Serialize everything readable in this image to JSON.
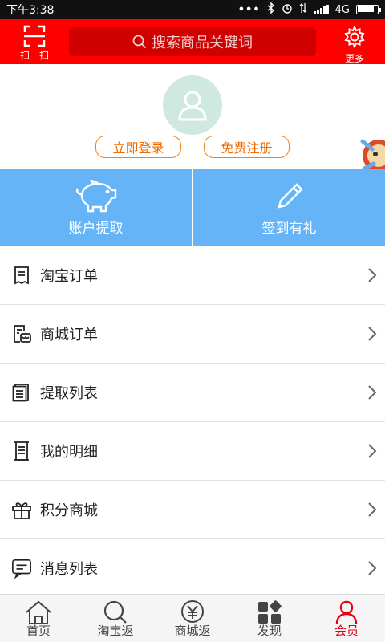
{
  "status": {
    "time": "下午3:38",
    "dots": "•••",
    "network": "4G"
  },
  "header": {
    "scan_label": "扫一扫",
    "search_placeholder": "搜索商品关键词",
    "more_label": "更多"
  },
  "profile": {
    "login_label": "立即登录",
    "register_label": "免费注册"
  },
  "tiles": [
    {
      "label": "账户提取",
      "icon": "piggy-bank-icon"
    },
    {
      "label": "签到有礼",
      "icon": "pencil-icon"
    }
  ],
  "menu": [
    {
      "label": "淘宝订单",
      "icon": "receipt-icon"
    },
    {
      "label": "商城订单",
      "icon": "shop-order-icon"
    },
    {
      "label": "提取列表",
      "icon": "list-doc-icon"
    },
    {
      "label": "我的明细",
      "icon": "detail-scroll-icon"
    },
    {
      "label": "积分商城",
      "icon": "gift-icon"
    },
    {
      "label": "消息列表",
      "icon": "message-icon"
    }
  ],
  "nav": [
    {
      "label": "首页",
      "icon": "home-icon"
    },
    {
      "label": "淘宝返",
      "icon": "search-icon"
    },
    {
      "label": "商城返",
      "icon": "yen-icon"
    },
    {
      "label": "发现",
      "icon": "grid-icon"
    },
    {
      "label": "会员",
      "icon": "member-icon",
      "active": true
    }
  ],
  "colors": {
    "header_red": "#ff0000",
    "tile_blue": "#64b4f7",
    "accent_orange": "#f06a00",
    "active_nav": "#e60012"
  },
  "battery_level": 0.85
}
